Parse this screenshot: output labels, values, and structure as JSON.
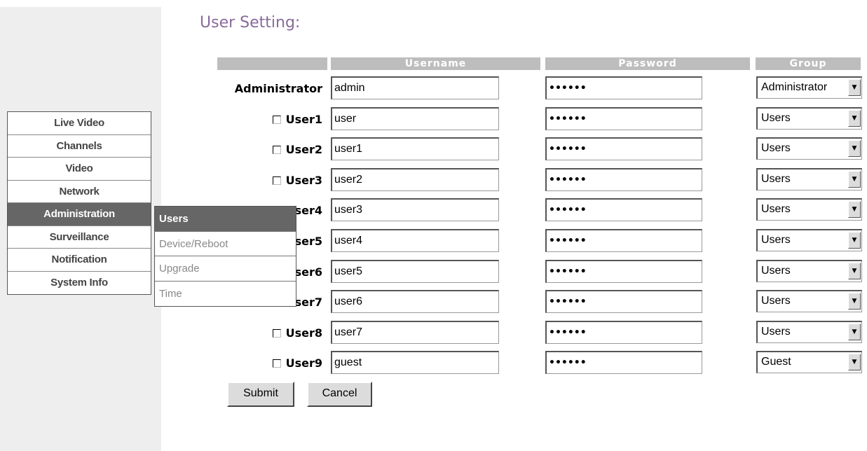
{
  "page": {
    "title": "User Setting:"
  },
  "table": {
    "headers": {
      "username": "Username",
      "password": "Password",
      "group": "Group"
    }
  },
  "nav": {
    "items": [
      {
        "label": "Live Video",
        "active": false
      },
      {
        "label": "Channels",
        "active": false
      },
      {
        "label": "Video",
        "active": false
      },
      {
        "label": "Network",
        "active": false
      },
      {
        "label": "Administration",
        "active": true
      },
      {
        "label": "Surveillance",
        "active": false
      },
      {
        "label": "Notification",
        "active": false
      },
      {
        "label": "System Info",
        "active": false
      }
    ]
  },
  "submenu": {
    "items": [
      {
        "label": "Users",
        "active": true
      },
      {
        "label": "Device/Reboot",
        "active": false
      },
      {
        "label": "Upgrade",
        "active": false
      },
      {
        "label": "Time",
        "active": false
      }
    ]
  },
  "users": [
    {
      "label": "Administrator",
      "checkbox": false,
      "username": "admin",
      "password": "••••••",
      "group": "Administrator"
    },
    {
      "label": "User1",
      "checkbox": true,
      "checked": false,
      "username": "user",
      "password": "••••••",
      "group": "Users"
    },
    {
      "label": "User2",
      "checkbox": true,
      "checked": false,
      "username": "user1",
      "password": "••••••",
      "group": "Users"
    },
    {
      "label": "User3",
      "checkbox": true,
      "checked": false,
      "username": "user2",
      "password": "••••••",
      "group": "Users"
    },
    {
      "label": "User4",
      "checkbox": true,
      "checked": false,
      "username": "user3",
      "password": "••••••",
      "group": "Users"
    },
    {
      "label": "User5",
      "checkbox": true,
      "checked": false,
      "username": "user4",
      "password": "••••••",
      "group": "Users"
    },
    {
      "label": "User6",
      "checkbox": true,
      "checked": false,
      "username": "user5",
      "password": "••••••",
      "group": "Users"
    },
    {
      "label": "User7",
      "checkbox": true,
      "checked": false,
      "username": "user6",
      "password": "••••••",
      "group": "Users"
    },
    {
      "label": "User8",
      "checkbox": true,
      "checked": false,
      "username": "user7",
      "password": "••••••",
      "group": "Users"
    },
    {
      "label": "User9",
      "checkbox": true,
      "checked": false,
      "username": "guest",
      "password": "••••••",
      "group": "Guest"
    }
  ],
  "buttons": {
    "submit": "Submit",
    "cancel": "Cancel"
  },
  "icons": {
    "checkbox": "checkbox-icon",
    "dropdown": "chevron-down-icon"
  },
  "colors": {
    "title": "#8a6a9a",
    "header_bg": "#bdbdbd",
    "active_menu": "#666666",
    "panel_bg": "#eeeeee"
  }
}
